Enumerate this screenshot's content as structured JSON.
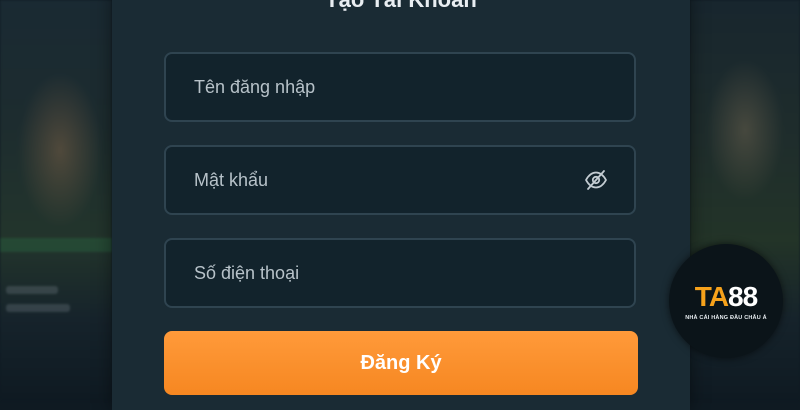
{
  "modal": {
    "title": "Tạo Tài Khoản"
  },
  "form": {
    "username": {
      "placeholder": "Tên đăng nhập",
      "value": ""
    },
    "password": {
      "placeholder": "Mật khẩu",
      "value": ""
    },
    "phone": {
      "placeholder": "Số điện thoại",
      "value": ""
    },
    "password_toggle_icon": "eye-off-icon",
    "submit_label": "Đăng Ký"
  },
  "logo": {
    "brand_prefix": "TA",
    "brand_suffix": "88",
    "tagline": "NHÀ CÁI HÀNG ĐẦU CHÂU Á"
  },
  "colors": {
    "accent": "#f68721",
    "modal_background": "#1a2b34",
    "field_border": "#2f4450",
    "brand_orange": "#f7a21b"
  }
}
